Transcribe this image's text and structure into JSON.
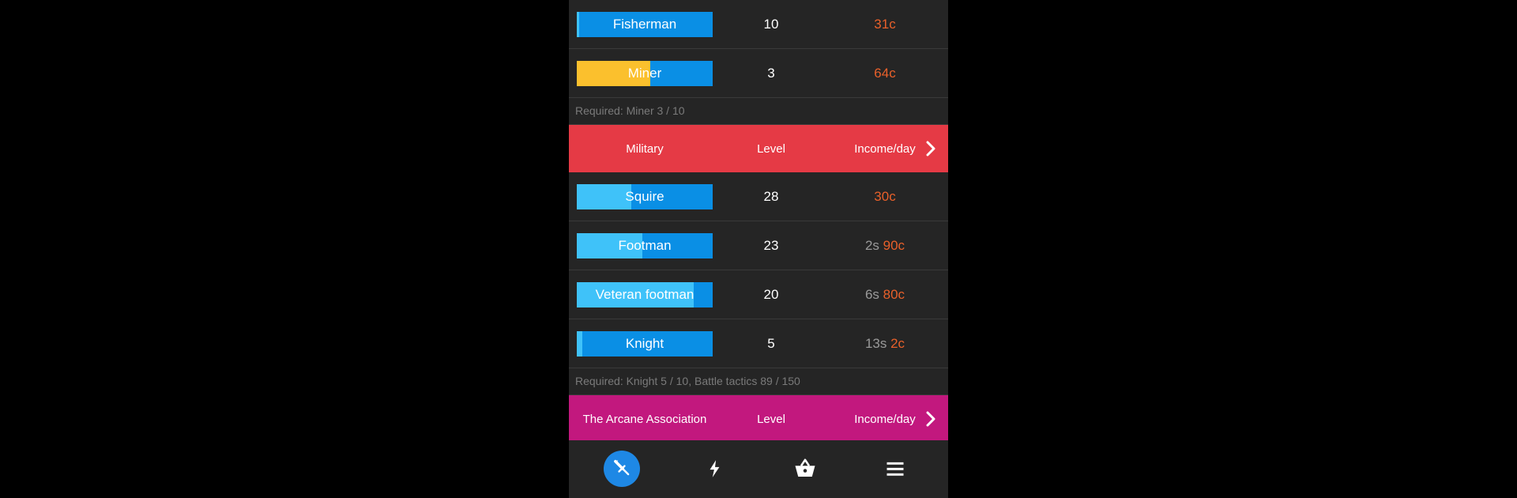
{
  "colors": {
    "bar_base": "#0a8fe5",
    "bar_fill": "#3fc2f9",
    "bar_fill_miner": "#fbc02d",
    "military_header": "#e53a45",
    "arcane_header": "#c2187e",
    "copper": "#e8602a",
    "silver": "#9a9a9a",
    "nav_active": "#1e88e5"
  },
  "commoner_jobs": [
    {
      "name": "Fisherman",
      "level": "10",
      "silver": "",
      "copper": "31c",
      "progress": 0.02,
      "fill": "#3fc2f9"
    },
    {
      "name": "Miner",
      "level": "3",
      "silver": "",
      "copper": "64c",
      "progress": 0.54,
      "fill": "#fbc02d"
    }
  ],
  "commoner_requirement": "Required: Miner 3 / 10",
  "military": {
    "title": "Military",
    "level_header": "Level",
    "income_header": "Income/day",
    "chevron_icon": "chevron-right-icon"
  },
  "military_jobs": [
    {
      "name": "Squire",
      "level": "28",
      "silver": "",
      "copper": "30c",
      "progress": 0.4,
      "fill": "#3fc2f9"
    },
    {
      "name": "Footman",
      "level": "23",
      "silver": "2s",
      "copper": "90c",
      "progress": 0.48,
      "fill": "#3fc2f9"
    },
    {
      "name": "Veteran footman",
      "level": "20",
      "silver": "6s",
      "copper": "80c",
      "progress": 0.86,
      "fill": "#3fc2f9"
    },
    {
      "name": "Knight",
      "level": "5",
      "silver": "13s",
      "copper": "2c",
      "progress": 0.04,
      "fill": "#3fc2f9"
    }
  ],
  "military_requirement": "Required: Knight 5 / 10, Battle tactics 89 / 150",
  "arcane": {
    "title": "The Arcane Association",
    "level_header": "Level",
    "income_header": "Income/day",
    "chevron_icon": "chevron-right-icon"
  },
  "nav": [
    {
      "icon": "sword-icon",
      "active": true
    },
    {
      "icon": "lightning-icon",
      "active": false
    },
    {
      "icon": "shopping-basket-icon",
      "active": false
    },
    {
      "icon": "menu-icon",
      "active": false
    }
  ]
}
